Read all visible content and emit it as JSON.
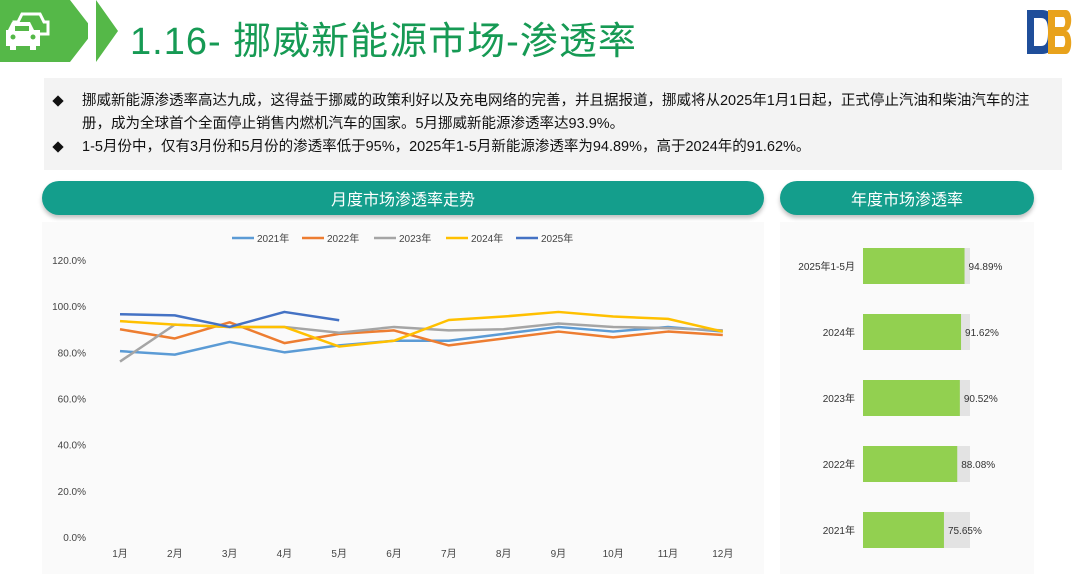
{
  "header": {
    "title": "1.16- 挪威新能源市场-渗透率",
    "logo_text": "DB",
    "colors": {
      "green": "#55b848",
      "title": "#169a54",
      "teal": "#149e8c"
    }
  },
  "intro": {
    "bullets": [
      "挪威新能源渗透率高达九成，这得益于挪威的政策利好以及充电网络的完善，并且据报道，挪威将从2025年1月1日起，正式停止汽油和柴油汽车的注册，成为全球首个全面停止销售内燃机汽车的国家。5月挪威新能源渗透率达93.9%。",
      "1-5月份中，仅有3月份和5月份的渗透率低于95%，2025年1-5月新能源渗透率为94.89%，高于2024年的91.62%。"
    ]
  },
  "panels": {
    "monthly_title": "月度市场渗透率走势",
    "annual_title": "年度市场渗透率"
  },
  "chart_data": [
    {
      "type": "line",
      "title": "月度市场渗透率走势",
      "categories": [
        "1月",
        "2月",
        "3月",
        "4月",
        "5月",
        "6月",
        "7月",
        "8月",
        "9月",
        "10月",
        "11月",
        "12月"
      ],
      "y_ticks": [
        "0.0%",
        "20.0%",
        "40.0%",
        "60.0%",
        "80.0%",
        "100.0%",
        "120.0%"
      ],
      "ylim": [
        0,
        120
      ],
      "grid": false,
      "legend": "top",
      "series": [
        {
          "name": "2021年",
          "color": "#5b9bd5",
          "values": [
            80.5,
            79,
            84.5,
            80,
            83,
            85,
            85,
            88,
            91,
            89,
            91,
            89
          ]
        },
        {
          "name": "2022年",
          "color": "#ed7d31",
          "values": [
            90,
            86,
            93,
            84,
            88,
            89.5,
            83,
            86,
            89,
            86.5,
            89,
            87.5
          ]
        },
        {
          "name": "2023年",
          "color": "#a5a5a5",
          "values": [
            76,
            92,
            91,
            91,
            88.5,
            91,
            89.5,
            90,
            92.5,
            91,
            90.5,
            89.5
          ]
        },
        {
          "name": "2024年",
          "color": "#ffc000",
          "values": [
            93.5,
            92,
            91,
            91,
            82.5,
            85,
            94,
            95.5,
            97.5,
            95.5,
            94.5,
            89
          ]
        },
        {
          "name": "2025年",
          "color": "#4472c4",
          "values": [
            96.5,
            96,
            91,
            97.5,
            93.9
          ]
        }
      ]
    },
    {
      "type": "bar",
      "title": "年度市场渗透率",
      "orientation": "horizontal",
      "categories": [
        "2025年1-5月",
        "2024年",
        "2023年",
        "2022年",
        "2021年"
      ],
      "values": [
        94.89,
        91.62,
        90.52,
        88.08,
        75.65
      ],
      "value_labels": [
        "94.89%",
        "91.62%",
        "90.52%",
        "88.08%",
        "75.65%"
      ],
      "max": 100,
      "bar_color": "#92d050",
      "track_color": "#e3e3e3"
    }
  ]
}
